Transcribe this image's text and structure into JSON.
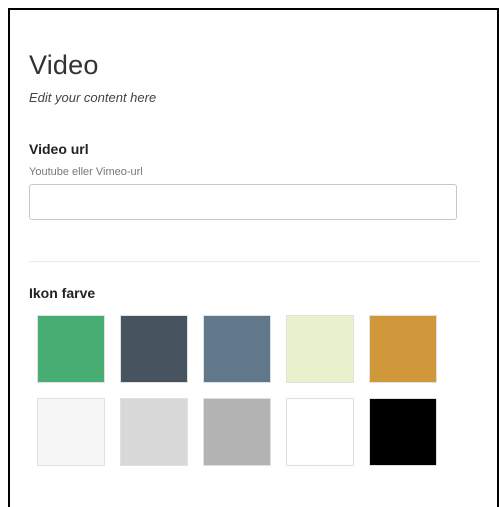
{
  "header": {
    "title": "Video",
    "subtitle": "Edit your content here"
  },
  "video_field": {
    "label": "Video url",
    "description": "Youtube eller Vimeo-url",
    "value": ""
  },
  "color_field": {
    "label": "Ikon farve",
    "swatches": [
      {
        "color": "#48ad73"
      },
      {
        "color": "#47545f"
      },
      {
        "color": "#61788a"
      },
      {
        "color": "#e8f0cc"
      },
      {
        "color": "#d1973b"
      },
      {
        "color": "#f7f7f7"
      },
      {
        "color": "#d8d8d8"
      },
      {
        "color": "#b3b3b3"
      },
      {
        "color": "#ffffff"
      },
      {
        "color": "#000000"
      }
    ]
  }
}
